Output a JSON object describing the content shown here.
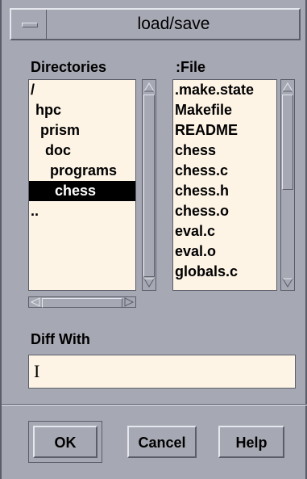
{
  "window": {
    "title": "load/save"
  },
  "directories": {
    "heading": "Directories",
    "items": [
      {
        "label": "/",
        "indent": 0,
        "selected": false
      },
      {
        "label": "hpc",
        "indent": 1,
        "selected": false
      },
      {
        "label": "prism",
        "indent": 2,
        "selected": false
      },
      {
        "label": "doc",
        "indent": 3,
        "selected": false
      },
      {
        "label": "programs",
        "indent": 4,
        "selected": false
      },
      {
        "label": "chess",
        "indent": 5,
        "selected": true
      },
      {
        "label": "..",
        "indent": 0,
        "selected": false
      }
    ]
  },
  "files": {
    "heading": ":File",
    "items": [
      ".make.state",
      "Makefile",
      "README",
      "chess",
      "chess.c",
      "chess.h",
      "chess.o",
      "eval.c",
      "eval.o",
      "globals.c"
    ]
  },
  "diff": {
    "label": "Diff With",
    "value": "",
    "caret": "I"
  },
  "buttons": {
    "ok": "OK",
    "cancel": "Cancel",
    "help": "Help"
  },
  "colors": {
    "background": "#a6a8b3",
    "list_bg": "#fdf4e6",
    "selection": "#000000"
  }
}
